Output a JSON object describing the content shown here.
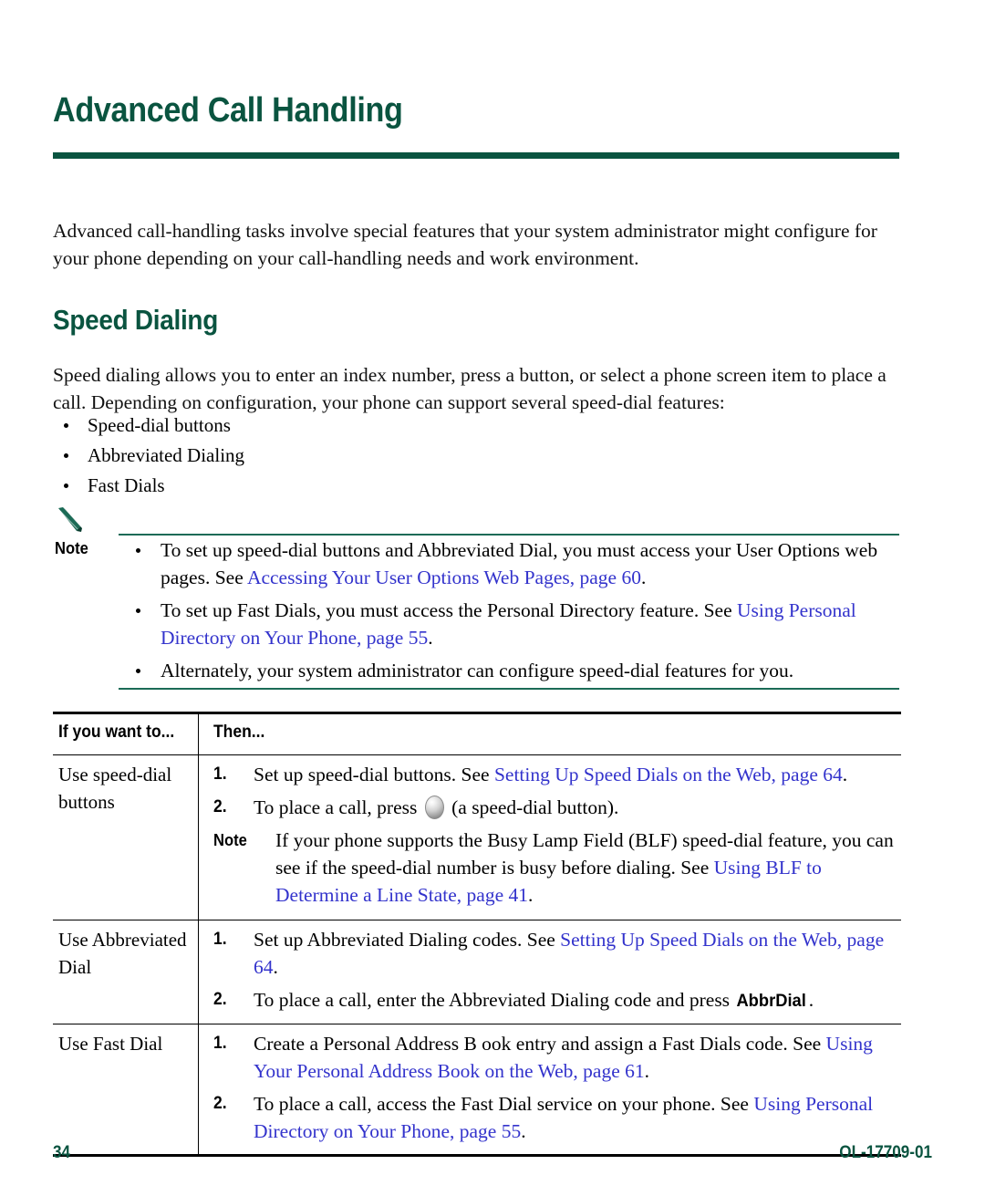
{
  "chapter": {
    "title": "Advanced Call Handling",
    "intro": "Advanced call-handling tasks involve special features that your system administrator might configure for your phone depending on your call-handling needs and work environment."
  },
  "section": {
    "heading": "Speed Dialing",
    "intro": "Speed dialing allows you to enter an index number, press a button, or select a phone screen item to place a call. Depending on configuration, your phone can support several speed-dial features:",
    "features": [
      "Speed-dial buttons",
      "Abbreviated Dialing",
      "Fast Dials"
    ]
  },
  "note": {
    "label": "Note",
    "icon": "pencil-icon",
    "items": [
      {
        "before": "To set up speed-dial buttons and Abbreviated Dial, you must access your User Options web pages. See ",
        "link": "Accessing Your User Options Web Pages, page 60",
        "after": "."
      },
      {
        "before": "To set up Fast Dials, you must access the Personal Directory feature. See ",
        "link": "Using Personal Directory on Your Phone, page 55",
        "after": "."
      },
      {
        "before": "Alternately, your system administrator can configure speed-dial features for you.",
        "link": "",
        "after": ""
      }
    ]
  },
  "table": {
    "headers": [
      "If you want to...",
      "Then..."
    ],
    "rows": [
      {
        "label": "Use speed-dial buttons",
        "steps": [
          {
            "num": "1.",
            "before": "Set up speed-dial buttons. See ",
            "link": "Setting Up Speed Dials on the Web, page 64",
            "after": "."
          },
          {
            "num": "2.",
            "before": "To place a call, press ",
            "icon": "speed-dial-button-icon",
            "after": " (a speed-dial button)."
          }
        ],
        "inner_note": {
          "label": "Note",
          "before": "If your phone supports the Busy Lamp Field (BLF) speed-dial feature, you can see if the speed-dial number is busy before dialing. See ",
          "link": "Using BLF to Determine a Line State, page 41",
          "after": "."
        }
      },
      {
        "label": "Use Abbreviated Dial",
        "steps": [
          {
            "num": "1.",
            "before": "Set up Abbreviated Dialing codes. See ",
            "link": "Setting Up Speed Dials on the Web, page 64",
            "after": "."
          },
          {
            "num": "2.",
            "before": "To place a call, enter the Abbreviated Dialing code and press ",
            "softkey": "AbbrDial",
            "after": "."
          }
        ]
      },
      {
        "label": "Use Fast Dial",
        "steps": [
          {
            "num": "1.",
            "before": "Create a Personal Address B ook entry and assign a Fast Dials code. See ",
            "link": "Using Your Personal Address Book on the Web, page 61",
            "after": "."
          },
          {
            "num": "2.",
            "before": "To place a call, access the Fast Dial service on your phone. See ",
            "link": "Using Personal Directory on Your Phone, page 55",
            "after": "."
          }
        ]
      }
    ]
  },
  "footer": {
    "page_number": "34",
    "document_id": "OL-17709-01"
  },
  "colors": {
    "brand_green": "#0A5440",
    "link_blue": "#3333CC",
    "rule_green": "#1B6B56"
  }
}
